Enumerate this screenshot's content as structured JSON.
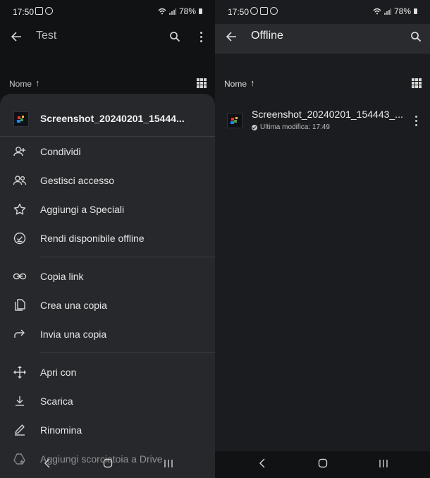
{
  "left": {
    "status": {
      "time": "17:50",
      "battery": "78%"
    },
    "appbar": {
      "title": "Test"
    },
    "sort": {
      "label": "Nome",
      "arrow": "↑"
    },
    "sheet": {
      "title": "Screenshot_20240201_15444...",
      "items": [
        {
          "label": "Condividi",
          "icon": "person-add-icon"
        },
        {
          "label": "Gestisci accesso",
          "icon": "people-icon"
        },
        {
          "label": "Aggiungi a Speciali",
          "icon": "star-icon"
        },
        {
          "label": "Rendi disponibile offline",
          "icon": "offline-icon"
        },
        {
          "label": "Copia link",
          "icon": "link-icon"
        },
        {
          "label": "Crea una copia",
          "icon": "copy-icon"
        },
        {
          "label": "Invia una copia",
          "icon": "forward-icon"
        },
        {
          "label": "Apri con",
          "icon": "open-with-icon"
        },
        {
          "label": "Scarica",
          "icon": "download-icon"
        },
        {
          "label": "Rinomina",
          "icon": "rename-icon"
        },
        {
          "label": "Aggiungi scorciatoia a Drive",
          "icon": "shortcut-icon"
        }
      ]
    }
  },
  "right": {
    "status": {
      "time": "17:50",
      "battery": "78%"
    },
    "appbar": {
      "title": "Offline"
    },
    "sort": {
      "label": "Nome",
      "arrow": "↑"
    },
    "file": {
      "name": "Screenshot_20240201_154443_...",
      "meta": "Ultima modifica: 17:49"
    }
  }
}
